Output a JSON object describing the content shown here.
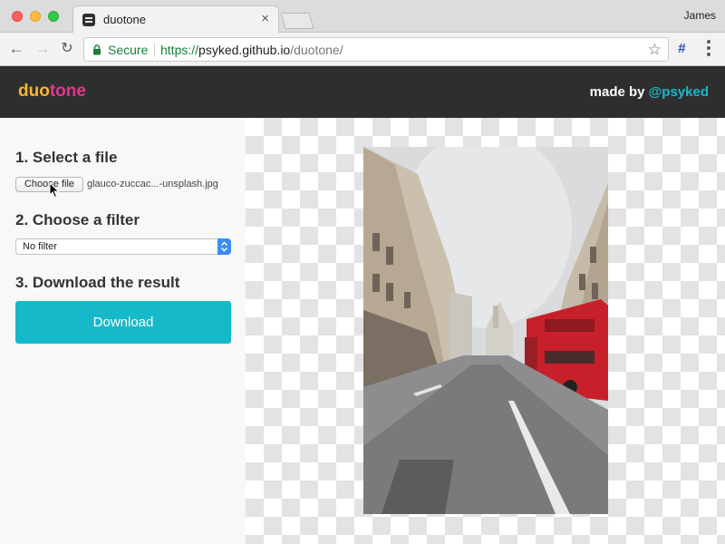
{
  "browser": {
    "tab_title": "duotone",
    "tab_close": "×",
    "profile_name": "James",
    "back_icon": "←",
    "forward_icon": "→",
    "reload_icon": "↻",
    "secure_label": "Secure",
    "url_scheme": "https://",
    "url_host": "psyked.github.io",
    "url_path": "/duotone/",
    "bookmark_icon": "☆",
    "extension_icon": "#"
  },
  "site": {
    "logo_part1": "duo",
    "logo_part2": "tone",
    "made_by_label": "made by ",
    "made_by_author": "@psyked"
  },
  "steps": {
    "select_file_title": "1. Select a file",
    "choose_file_label": "Choose file",
    "file_name": "glauco-zuccac...-unsplash.jpg",
    "choose_filter_title": "2. Choose a filter",
    "filter_selected": "No filter",
    "download_title": "3. Download the result",
    "download_label": "Download"
  },
  "colors": {
    "header_bg": "#2e2e2e",
    "logo_duo": "#f7b731",
    "logo_tone": "#e3358b",
    "accent": "#16b9c9",
    "secure_green": "#188038"
  }
}
